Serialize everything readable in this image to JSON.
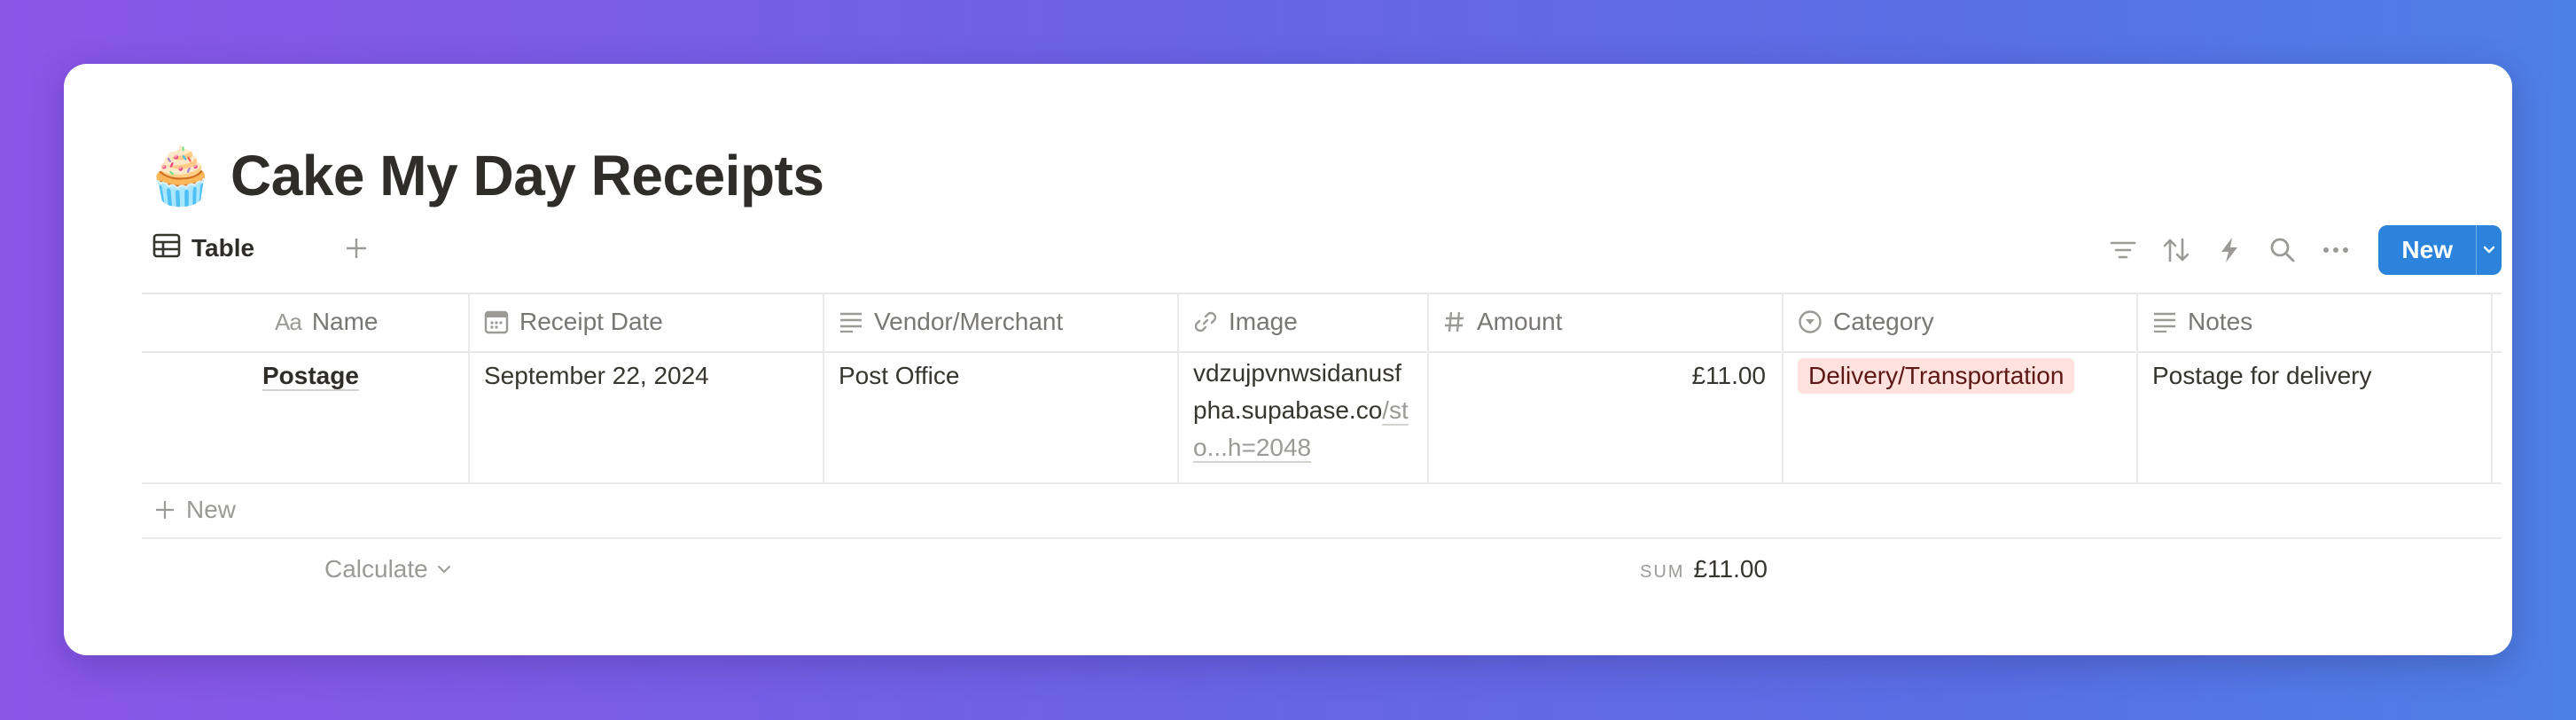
{
  "page": {
    "emoji": "🧁",
    "title": "Cake My Day Receipts"
  },
  "view": {
    "active_tab": "Table",
    "new_button_label": "New"
  },
  "toolbar": {
    "icons": [
      "filter-icon",
      "sort-icon",
      "automation-bolt-icon",
      "search-icon",
      "more-icon"
    ]
  },
  "table": {
    "columns": [
      {
        "label": "Name",
        "icon": "text-aa-icon"
      },
      {
        "label": "Receipt Date",
        "icon": "calendar-icon"
      },
      {
        "label": "Vendor/Merchant",
        "icon": "text-lines-icon"
      },
      {
        "label": "Image",
        "icon": "link-icon"
      },
      {
        "label": "Amount",
        "icon": "hash-icon"
      },
      {
        "label": "Category",
        "icon": "select-icon"
      },
      {
        "label": "Notes",
        "icon": "text-lines-icon"
      }
    ],
    "rows": [
      {
        "name": "Postage",
        "receipt_date": "September 22, 2024",
        "vendor": "Post Office",
        "image_visible": "vdzujpvnwsidanusfpha.supabase.co",
        "image_faded": "/sto...h=2048",
        "amount": "£11.00",
        "category": "Delivery/Transportation",
        "notes": "Postage for delivery"
      }
    ],
    "new_row_label": "New",
    "footer": {
      "calculate_label": "Calculate",
      "sum_label": "SUM",
      "sum_value": "£11.00"
    }
  },
  "colors": {
    "accent": "#2b83dc",
    "category_tag_bg": "#ffe2dd",
    "category_tag_text": "#5d1715"
  }
}
